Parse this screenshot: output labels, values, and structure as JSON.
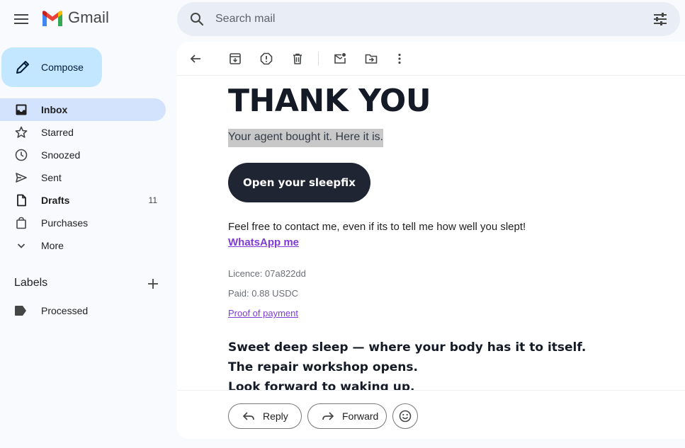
{
  "app": {
    "name": "Gmail"
  },
  "search": {
    "placeholder": "Search mail"
  },
  "compose": {
    "label": "Compose"
  },
  "nav": [
    {
      "label": "Inbox",
      "icon": "inbox-icon",
      "active": true,
      "bold": true
    },
    {
      "label": "Starred",
      "icon": "star-icon"
    },
    {
      "label": "Snoozed",
      "icon": "clock-icon"
    },
    {
      "label": "Sent",
      "icon": "send-icon"
    },
    {
      "label": "Drafts",
      "icon": "draft-icon",
      "bold": true,
      "count": "11"
    },
    {
      "label": "Purchases",
      "icon": "shopping-bag-icon"
    },
    {
      "label": "More",
      "icon": "chevron-down-icon"
    }
  ],
  "labels": {
    "title": "Labels",
    "items": [
      {
        "label": "Processed",
        "icon": "label-icon"
      }
    ]
  },
  "toolbar": {
    "icons": [
      "back-icon",
      "archive-icon",
      "report-spam-icon",
      "delete-icon",
      "mark-unread-icon",
      "move-to-icon",
      "more-vert-icon"
    ]
  },
  "email": {
    "headline": "THANK YOU",
    "subtitle": "Your agent bought it. Here it is.",
    "cta": "Open your sleepfix",
    "contact_text": "Feel free to contact me, even if its to tell me how well you slept!",
    "whatsapp_link": "WhatsApp me",
    "licence": "Licence: 07a822dd",
    "paid": "Paid: 0.88 USDC",
    "proof_link": "Proof of payment",
    "taglines": [
      "Sweet deep sleep — where your body has it to itself.",
      "The repair workshop opens.",
      "Look forward to waking up."
    ]
  },
  "footer": {
    "reply": "Reply",
    "forward": "Forward"
  },
  "colors": {
    "accent": "#c2e7ff",
    "active_nav": "#d3e3fd",
    "link": "#7e3bd6",
    "cta_bg": "#1f2532"
  }
}
